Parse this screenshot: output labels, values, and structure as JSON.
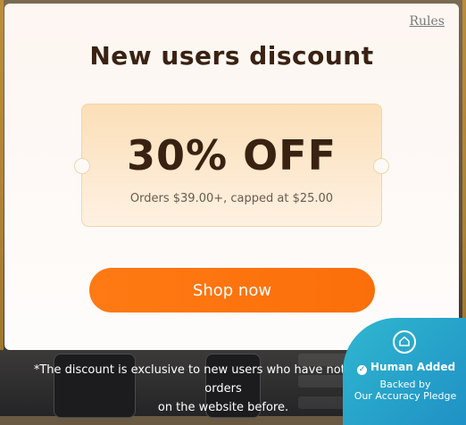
{
  "modal": {
    "rules_link": "Rules",
    "title": "New users discount",
    "coupon": {
      "amount": "30% OFF",
      "conditions": "Orders $39.00+, capped at $25.00"
    },
    "cta_label": "Shop now"
  },
  "disclaimer": {
    "line1": "*The discount is exclusive to new users who have not placed any orders",
    "line2": "on the website before."
  },
  "badge": {
    "icon": "home-shield-icon",
    "title": "Human Added",
    "line1": "Backed by",
    "line2": "Our Accuracy Pledge"
  },
  "colors": {
    "accent": "#fb6f0a",
    "title": "#3a2212",
    "badge": "#1f8fc5"
  }
}
